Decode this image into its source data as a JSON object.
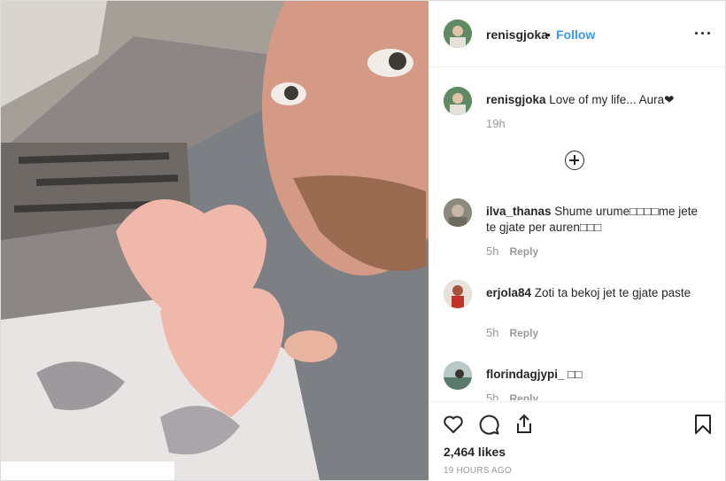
{
  "post": {
    "username": "renisgjoka",
    "separator": "•",
    "follow_label": "Follow",
    "caption_user": "renisgjoka",
    "caption_text": " Love of my life... Aura❤",
    "caption_age": "19h",
    "likes": "2,464 likes",
    "timestamp": "19 HOURS AGO"
  },
  "comments": [
    {
      "user": "ilva_thanas",
      "text": " Shume urume□□□□me jete te gjate per auren□□□",
      "age": "5h",
      "reply_label": "Reply"
    },
    {
      "user": "erjola84",
      "text": " Zoti ta bekoj jet te gjate paste",
      "age": "5h",
      "reply_label": "Reply"
    },
    {
      "user": "florindagjypi_",
      "text": " □□",
      "age": "5h",
      "reply_label": "Reply"
    }
  ],
  "icons": {
    "more": "more-options-icon",
    "load_more": "load-more-comments-icon",
    "like": "heart-icon",
    "comment": "comment-bubble-icon",
    "share": "share-icon",
    "save": "bookmark-icon"
  },
  "colors": {
    "accent": "#3897f0",
    "text": "#262626",
    "muted": "#999999"
  }
}
